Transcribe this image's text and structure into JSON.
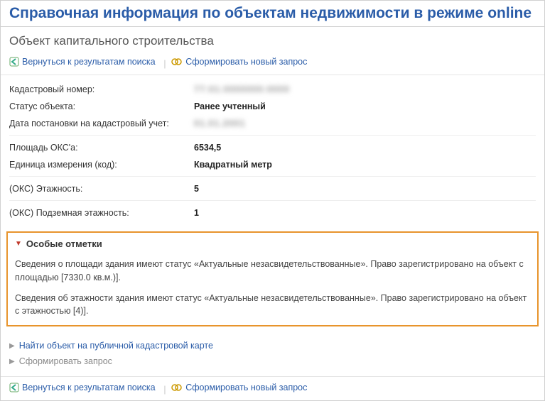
{
  "title": "Справочная информация по объектам недвижимости в режиме online",
  "subtitle": "Объект капитального строительства",
  "toolbar": {
    "back_label": "Вернуться к результатам поиска",
    "new_label": "Сформировать новый запрос"
  },
  "fields": {
    "cad_number_label": "Кадастровый номер:",
    "cad_number_value": "77:01:0000000:0000",
    "status_label": "Статус объекта:",
    "status_value": "Ранее учтенный",
    "reg_date_label": "Дата постановки на кадастровый учет:",
    "reg_date_value": "01.01.2001",
    "area_label": "Площадь ОКС'a:",
    "area_value": "6534,5",
    "unit_label": "Единица измерения (код):",
    "unit_value": "Квадратный метр",
    "floors_label": "(ОКС) Этажность:",
    "floors_value": "5",
    "ufloors_label": "(ОКС) Подземная этажность:",
    "ufloors_value": "1"
  },
  "notes": {
    "header": "Особые отметки",
    "p1": "Сведения о площади здания имеют статус «Актуальные незасвидетельствованные». Право зарегистрировано на объект с площадью [7330.0 кв.м.)].",
    "p2": "Сведения об этажности здания имеют статус «Актуальные незасвидетельствованные». Право зарегистрировано на объект с этажностью [4)]."
  },
  "bottom": {
    "map_label": "Найти объект на публичной кадастровой карте",
    "form_label": "Сформировать запрос"
  }
}
